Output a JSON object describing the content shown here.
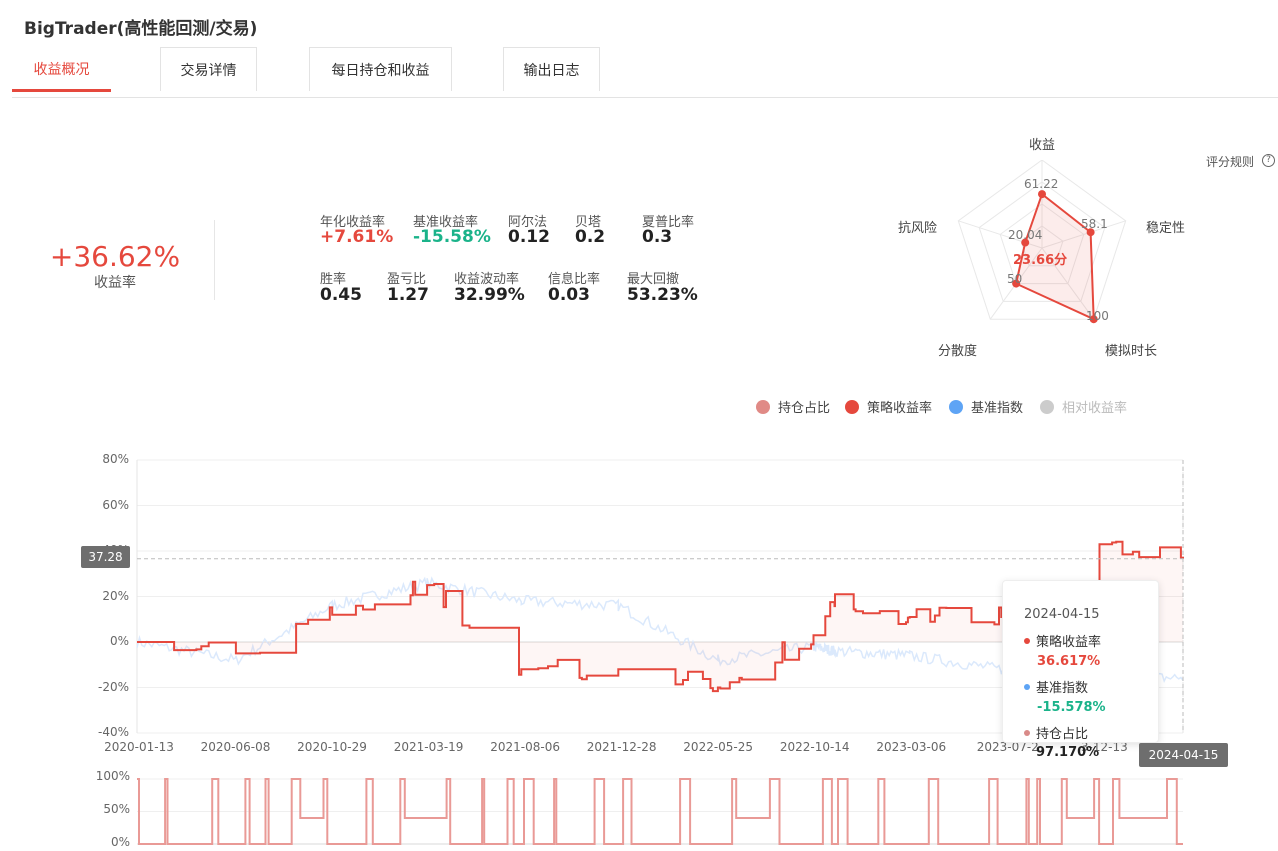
{
  "app": {
    "title": "BigTrader(高性能回测/交易)"
  },
  "tabs": [
    {
      "label": "收益概况",
      "active": true
    },
    {
      "label": "交易详情",
      "active": false
    },
    {
      "label": "每日持仓和收益",
      "active": false
    },
    {
      "label": "输出日志",
      "active": false
    }
  ],
  "summary": {
    "total_return": "+36.62%",
    "total_return_label": "收益率"
  },
  "metrics": [
    {
      "label": "年化收益率",
      "value": "+7.61%",
      "tone": "pos"
    },
    {
      "label": "基准收益率",
      "value": "-15.58%",
      "tone": "neg"
    },
    {
      "label": "阿尔法",
      "value": "0.12",
      "tone": ""
    },
    {
      "label": "贝塔",
      "value": "0.2",
      "tone": ""
    },
    {
      "label": "夏普比率",
      "value": "0.3",
      "tone": ""
    },
    {
      "label": "胜率",
      "value": "0.45",
      "tone": ""
    },
    {
      "label": "盈亏比",
      "value": "1.27",
      "tone": ""
    },
    {
      "label": "收益波动率",
      "value": "32.99%",
      "tone": ""
    },
    {
      "label": "信息比率",
      "value": "0.03",
      "tone": ""
    },
    {
      "label": "最大回撤",
      "value": "53.23%",
      "tone": ""
    }
  ],
  "score_rule": {
    "label": "评分规则",
    "icon": "question-circle-icon"
  },
  "radar": {
    "score": "23.66分",
    "dimensions": [
      {
        "label": "收益",
        "value": "61.22",
        "score": 61.22
      },
      {
        "label": "稳定性",
        "value": "58.1",
        "score": 58.1
      },
      {
        "label": "模拟时长",
        "value": "100",
        "score": 100
      },
      {
        "label": "分散度",
        "value": "50",
        "score": 50
      },
      {
        "label": "抗风险",
        "value": "20.04",
        "score": 20.04
      }
    ],
    "color": "#e5483d"
  },
  "legend": [
    {
      "label": "持仓占比",
      "color": "#e08a86",
      "enabled": true
    },
    {
      "label": "策略收益率",
      "color": "#e5483d",
      "enabled": true
    },
    {
      "label": "基准指数",
      "color": "#5ea4f5",
      "enabled": true
    },
    {
      "label": "相对收益率",
      "color": "#cccccc",
      "enabled": false
    }
  ],
  "chart_data": [
    {
      "type": "line",
      "title": "",
      "x": [
        "2020-01-13",
        "2020-06-08",
        "2020-10-29",
        "2021-03-19",
        "2021-08-06",
        "2021-12-28",
        "2022-05-25",
        "2022-10-14",
        "2023-03-06",
        "2023-07-2",
        "2023-12-13",
        "2024-04-15"
      ],
      "x_tick_labels": [
        "2020-01-13",
        "2020-06-08",
        "2020-10-29",
        "2021-03-19",
        "2021-08-06",
        "2021-12-28",
        "2022-05-25",
        "2022-10-14",
        "2023-03-06",
        "2023-07-2",
        "3-12-13"
      ],
      "y_tick_labels": [
        "80%",
        "60%",
        "40%",
        "20%",
        "0%",
        "-20%",
        "-40%"
      ],
      "ylim": [
        -40,
        80
      ],
      "grid": true,
      "series": [
        {
          "name": "策略收益率",
          "color": "#e5483d",
          "values": [
            0,
            -5,
            12,
            25,
            -12,
            -12,
            -20,
            3,
            21,
            11,
            11,
            43,
            36.62
          ]
        },
        {
          "name": "基准指数",
          "color": "#5ea4f5",
          "values": [
            0,
            -8,
            16,
            26,
            18,
            16,
            -8,
            -2,
            -4,
            -6,
            -12,
            -16,
            -15.58
          ]
        }
      ],
      "series_x": [
        "2020-01-13",
        "2020-06-08",
        "2020-10-29",
        "2021-03-19",
        "2021-08-06",
        "2021-12-28",
        "2022-05-25",
        "2022-10-14",
        "2022-11-15",
        "2023-03-06",
        "2023-07-20",
        "2023-12-13",
        "2024-04-15"
      ]
    },
    {
      "type": "area",
      "title": "",
      "y_tick_labels": [
        "100%",
        "50%",
        "0%"
      ],
      "ylim": [
        0,
        100
      ],
      "series": [
        {
          "name": "持仓占比",
          "color": "#e99a96"
        }
      ]
    }
  ],
  "cursor": {
    "y_label": "37.28",
    "x_label": "2024-04-15"
  },
  "tooltip": {
    "date": "2024-04-15",
    "strategy_label": "策略收益率",
    "strategy_value": "36.617%",
    "strategy_color": "#e5483d",
    "benchmark_label": "基准指数",
    "benchmark_value": "-15.578%",
    "benchmark_color": "#5ea4f5",
    "position_label": "持仓占比",
    "position_value": "97.170%",
    "position_color": "#d98a88"
  }
}
